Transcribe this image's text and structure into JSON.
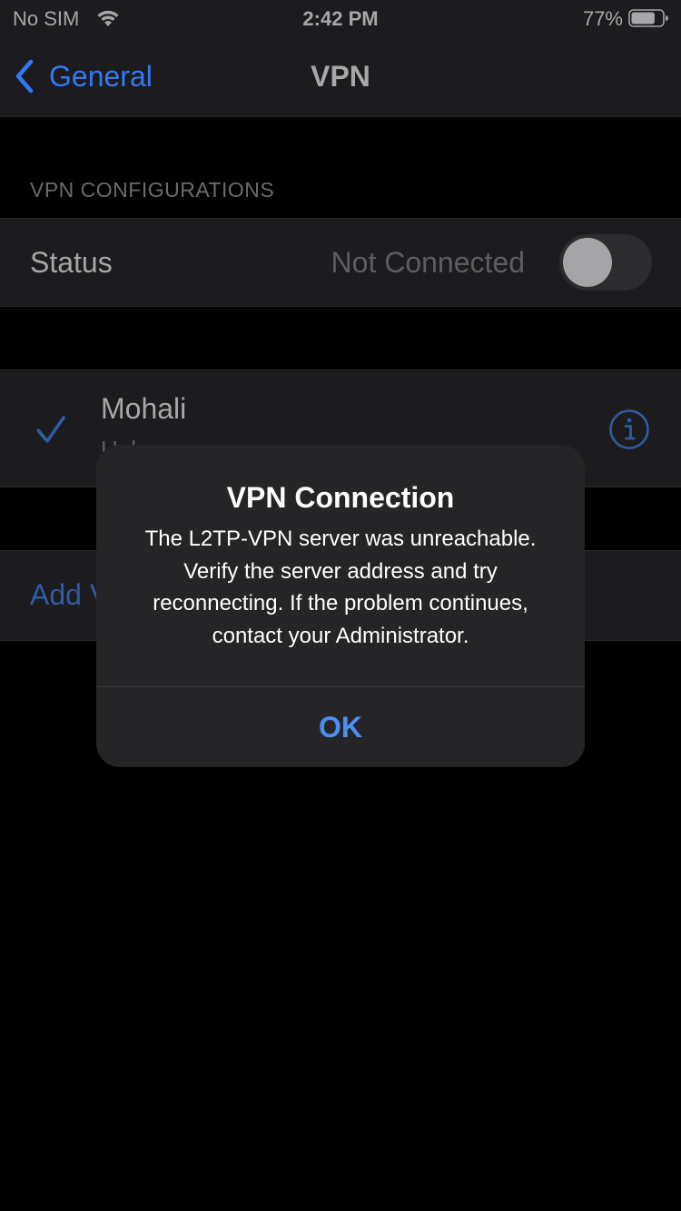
{
  "status_bar": {
    "carrier": "No SIM",
    "time": "2:42 PM",
    "battery_percent": "77%",
    "battery_level": 0.77,
    "wifi_icon": "wifi-icon",
    "battery_icon": "battery-icon"
  },
  "nav": {
    "back_label": "General",
    "title": "VPN",
    "back_icon": "chevron-left-icon"
  },
  "vpn_section": {
    "header": "VPN CONFIGURATIONS",
    "status_label": "Status",
    "status_value": "Not Connected",
    "toggle_on": false
  },
  "profiles": [
    {
      "name": "Mohali",
      "subtitle": "Unknown",
      "selected": true,
      "check_icon": "checkmark-icon",
      "info_icon": "info-icon"
    }
  ],
  "add_vpn": {
    "label": "Add VPN Configuration..."
  },
  "alert": {
    "title": "VPN Connection",
    "message": "The L2TP-VPN server was unreachable. Verify the server address and try reconnecting. If the problem continues, contact your Administrator.",
    "ok_label": "OK"
  },
  "colors": {
    "accent": "#3478f6",
    "alert_button": "#4c8ff4",
    "background": "#000000",
    "cell_background": "#1c1c1e",
    "alert_background": "#252527"
  }
}
